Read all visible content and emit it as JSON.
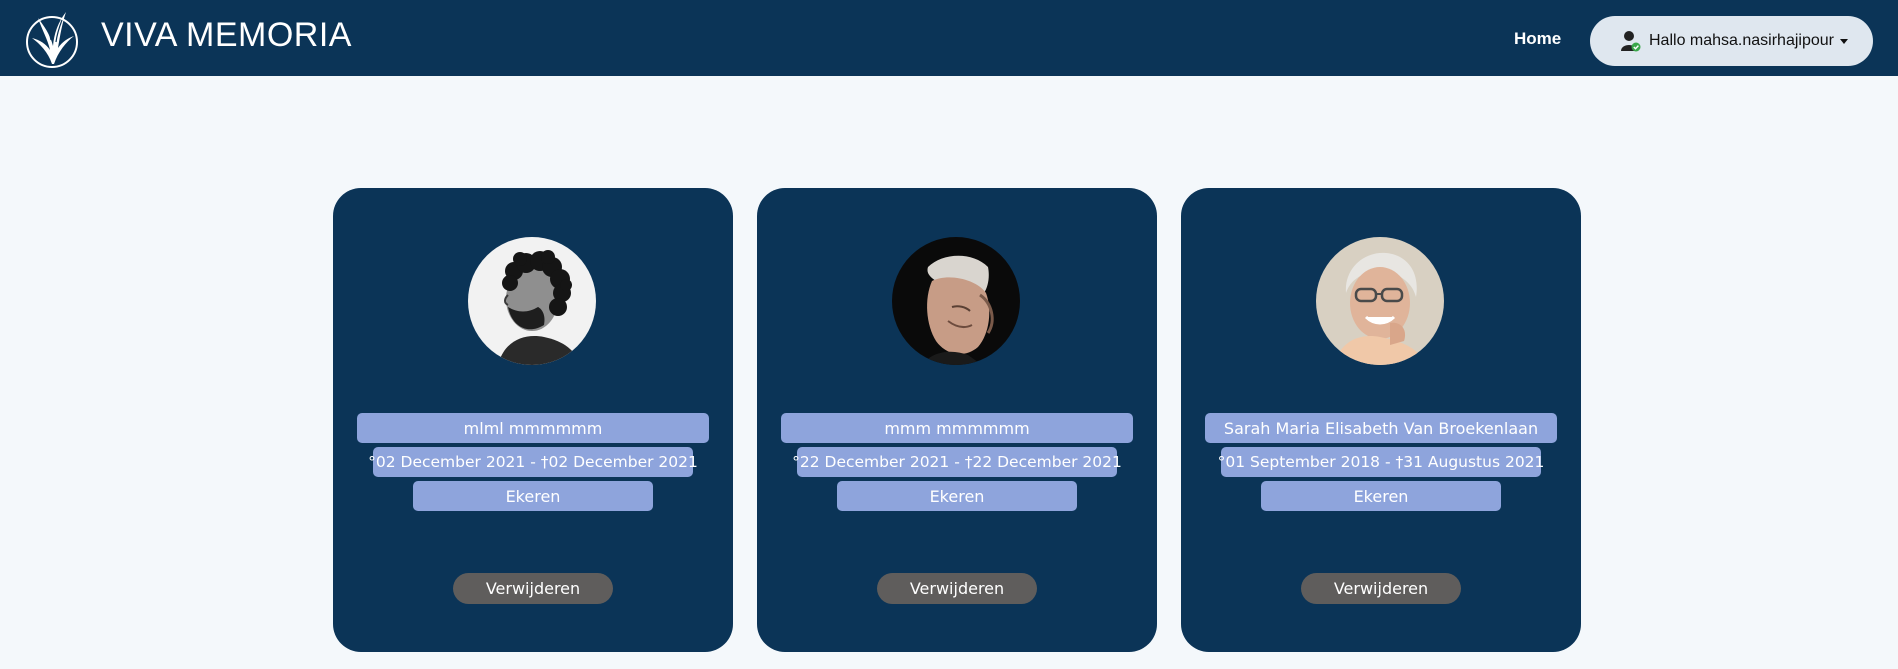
{
  "header": {
    "brand": "VIVA MEMORIA",
    "home_label": "Home",
    "user_label": "Hallo mahsa.nasirhajipour"
  },
  "cards": [
    {
      "name": "mlml mmmmmm",
      "dates": "°02 December 2021 - †02 December 2021",
      "place": "Ekeren",
      "delete_label": "Verwijderen"
    },
    {
      "name": "mmm mmmmmm",
      "dates": "°22 December 2021 - †22 December 2021",
      "place": "Ekeren",
      "delete_label": "Verwijderen"
    },
    {
      "name": "Sarah Maria Elisabeth Van Broekenlaan",
      "dates": "°01 September 2018 - †31 Augustus 2021",
      "place": "Ekeren",
      "delete_label": "Verwijderen"
    }
  ],
  "colors": {
    "navbar": "#0b3457",
    "card": "#0b3457",
    "pill": "#8ea4dc",
    "delete_button": "#5f5d5c",
    "background": "#f4f8fb"
  }
}
